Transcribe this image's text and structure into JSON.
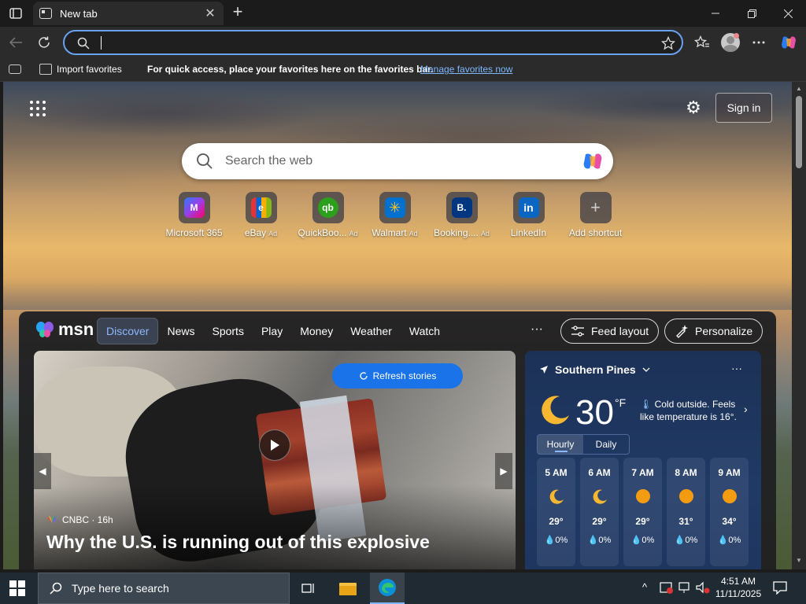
{
  "browser": {
    "tab_title": "New tab",
    "tab_close": "✕",
    "new_tab": "+",
    "address_value": ""
  },
  "favorites_bar": {
    "import_label": "Import favorites",
    "message": "For quick access, place your favorites here on the favorites bar.",
    "manage_link": "Manage favorites now"
  },
  "newtab": {
    "sign_in": "Sign in",
    "search_placeholder": "Search the web",
    "shortcuts": [
      {
        "label": "Microsoft 365",
        "ad": "",
        "logo": "M",
        "color": "#5b4bd6"
      },
      {
        "label": "eBay",
        "ad": "Ad",
        "logo": "e",
        "color": "#e53238"
      },
      {
        "label": "QuickBoo...",
        "ad": "Ad",
        "logo": "qb",
        "color": "#2ca01c"
      },
      {
        "label": "Walmart",
        "ad": "Ad",
        "logo": "✳",
        "color": "#0071ce"
      },
      {
        "label": "Booking....",
        "ad": "Ad",
        "logo": "B.",
        "color": "#003580"
      },
      {
        "label": "LinkedIn",
        "ad": "",
        "logo": "in",
        "color": "#0a66c2"
      },
      {
        "label": "Add shortcut",
        "ad": "",
        "logo": "+",
        "color": "transparent"
      }
    ]
  },
  "msn": {
    "logo": "msn",
    "nav": [
      "Discover",
      "News",
      "Sports",
      "Play",
      "Money",
      "Weather",
      "Watch"
    ],
    "more": "···",
    "feed_layout": "Feed layout",
    "personalize": "Personalize",
    "refresh": "Refresh stories",
    "hero": {
      "source": "CNBC · 16h",
      "headline": "Why the U.S. is running out of this explosive"
    }
  },
  "weather": {
    "location": "Southern Pines",
    "temp": "30",
    "unit": "°F",
    "description": "Cold outside. Feels like temperature is 16°.",
    "tabs": [
      "Hourly",
      "Daily"
    ],
    "hours": [
      {
        "time": "5 AM",
        "icon": "moon",
        "temp": "29°",
        "precip": "0%"
      },
      {
        "time": "6 AM",
        "icon": "moon",
        "temp": "29°",
        "precip": "0%"
      },
      {
        "time": "7 AM",
        "icon": "sun",
        "temp": "29°",
        "precip": "0%"
      },
      {
        "time": "8 AM",
        "icon": "sun",
        "temp": "31°",
        "precip": "0%"
      },
      {
        "time": "9 AM",
        "icon": "sun",
        "temp": "34°",
        "precip": "0%"
      }
    ]
  },
  "taskbar": {
    "search_placeholder": "Type here to search",
    "time": "4:51 AM",
    "date": "11/11/2025"
  }
}
